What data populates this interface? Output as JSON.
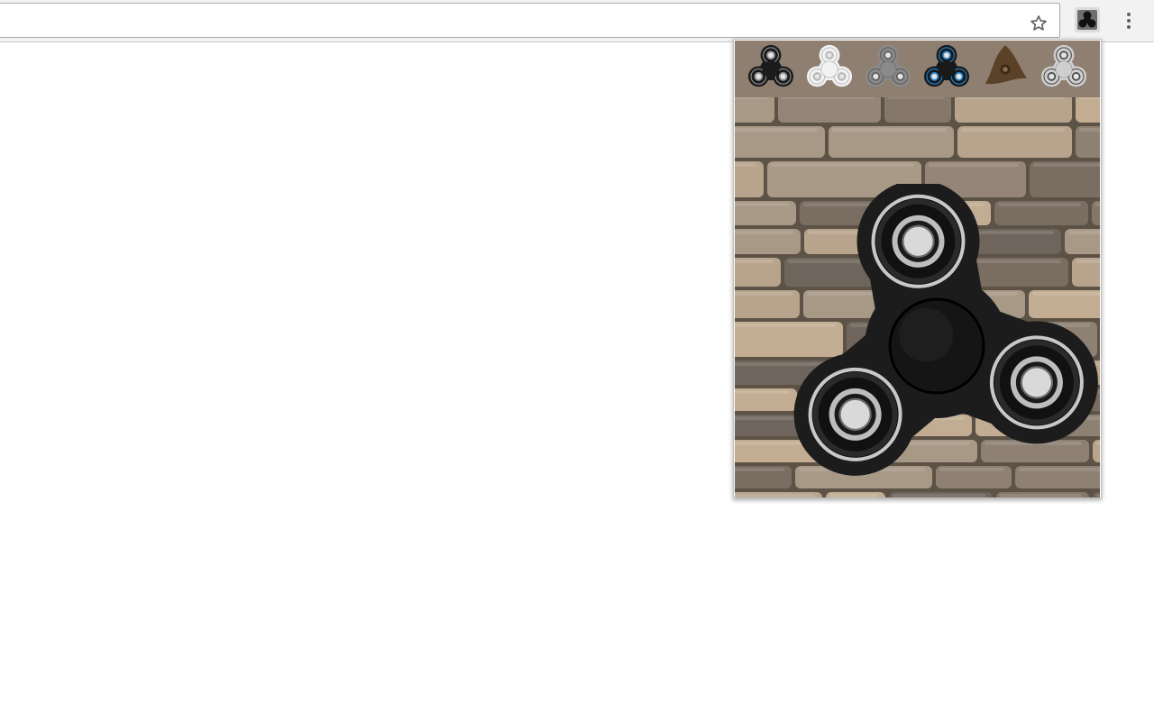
{
  "browser": {
    "address_value": "",
    "bookmark_icon": "star-outline-icon",
    "extension_icon": "fidget-spinner-extension-icon",
    "menu_icon": "vertical-dots-menu-icon"
  },
  "popup": {
    "spinner_options": [
      {
        "id": "black",
        "icon": "black-spinner-icon",
        "body": "#1c1c1c",
        "ring": "#9a9a9a"
      },
      {
        "id": "white",
        "icon": "white-spinner-icon",
        "body": "#f2f2f2",
        "ring": "#bdbdbd"
      },
      {
        "id": "gray",
        "icon": "gray-spinner-icon",
        "body": "#8a8a8a",
        "ring": "#5a5a5a"
      },
      {
        "id": "blue",
        "icon": "blue-spinner-icon",
        "body": "#1a1a1a",
        "ring": "#1e90e6"
      },
      {
        "id": "bronze",
        "icon": "bronze-spinner-icon",
        "body": "#5a4128",
        "ring": "#3a2a18"
      },
      {
        "id": "silver",
        "icon": "silver-spinner-icon",
        "body": "#cfcfcf",
        "ring": "#444444"
      }
    ],
    "active_spinner": "black",
    "picker_background": "#8f7f70",
    "wall_background": "stone-wall"
  }
}
